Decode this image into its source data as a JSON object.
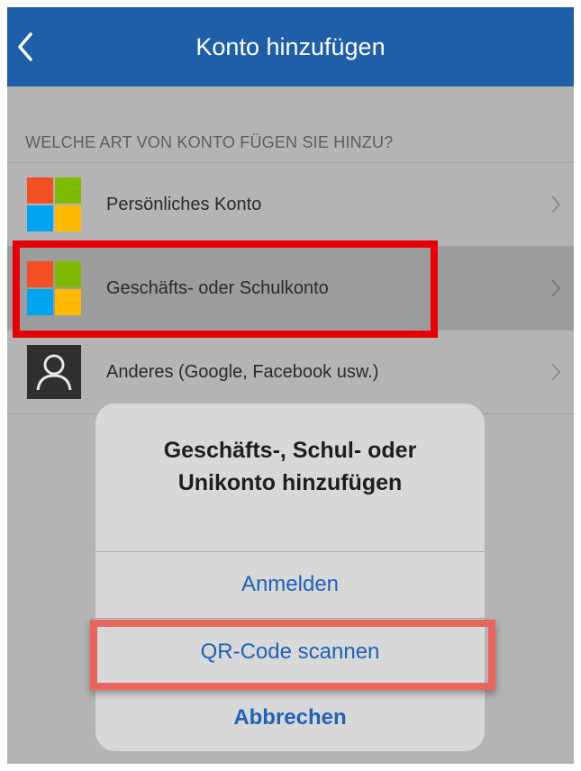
{
  "navbar": {
    "title": "Konto hinzufügen",
    "back_icon": "chevron-left-icon"
  },
  "section": {
    "header": "WELCHE ART VON KONTO FÜGEN SIE HINZU?"
  },
  "accounts": [
    {
      "label": "Persönliches Konto",
      "icon": "microsoft-logo-icon",
      "selected": false
    },
    {
      "label": "Geschäfts- oder Schulkonto",
      "icon": "microsoft-logo-icon",
      "selected": true
    },
    {
      "label": "Anderes (Google, Facebook usw.)",
      "icon": "person-icon",
      "selected": false
    }
  ],
  "action_sheet": {
    "title_line1": "Geschäfts-, Schul- oder",
    "title_line2": "Unikonto hinzufügen",
    "sign_in": "Anmelden",
    "scan_qr": "QR-Code scannen",
    "cancel": "Abbrechen"
  },
  "colors": {
    "navbar": "#1f5fa8",
    "action_text": "#1d63b8",
    "highlight_red": "#e6000a",
    "highlight_coral": "#e8655d",
    "ms_red": "#f25022",
    "ms_green": "#7fba00",
    "ms_blue": "#00a4ef",
    "ms_yellow": "#ffb900"
  }
}
